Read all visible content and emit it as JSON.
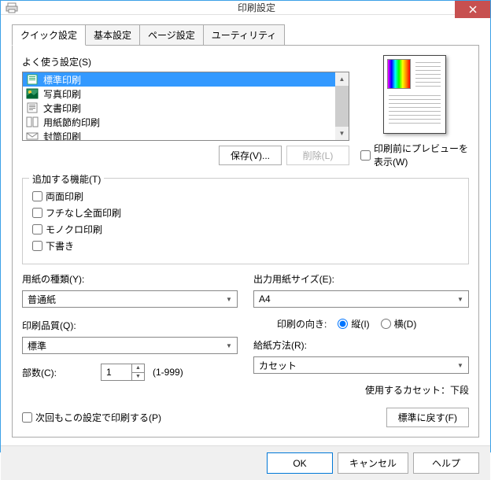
{
  "window": {
    "title": "印刷設定"
  },
  "tabs": {
    "quick": "クイック設定",
    "basic": "基本設定",
    "page": "ページ設定",
    "utility": "ユーティリティ"
  },
  "presets": {
    "label": "よく使う設定(S)",
    "items": [
      "標準印刷",
      "写真印刷",
      "文書印刷",
      "用紙節約印刷",
      "封筒印刷"
    ],
    "save_btn": "保存(V)...",
    "delete_btn": "削除(L)"
  },
  "preview": {
    "check_label": "印刷前にプレビューを表示(W)"
  },
  "additional": {
    "legend": "追加する機能(T)",
    "duplex": "両面印刷",
    "borderless": "フチなし全面印刷",
    "mono": "モノクロ印刷",
    "draft": "下書き"
  },
  "media": {
    "label": "用紙の種類(Y):",
    "value": "普通紙"
  },
  "quality": {
    "label": "印刷品質(Q):",
    "value": "標準"
  },
  "copies": {
    "label": "部数(C):",
    "value": "1",
    "range": "(1-999)"
  },
  "papersize": {
    "label": "出力用紙サイズ(E):",
    "value": "A4"
  },
  "orient": {
    "label": "印刷の向き:",
    "portrait": "縦(I)",
    "landscape": "横(D)"
  },
  "source": {
    "label": "給紙方法(R):",
    "value": "カセット"
  },
  "cassette_note": "使用するカセット：下段",
  "always": "次回もこの設定で印刷する(P)",
  "defaults_btn": "標準に戻す(F)",
  "buttons": {
    "ok": "OK",
    "cancel": "キャンセル",
    "help": "ヘルプ"
  }
}
